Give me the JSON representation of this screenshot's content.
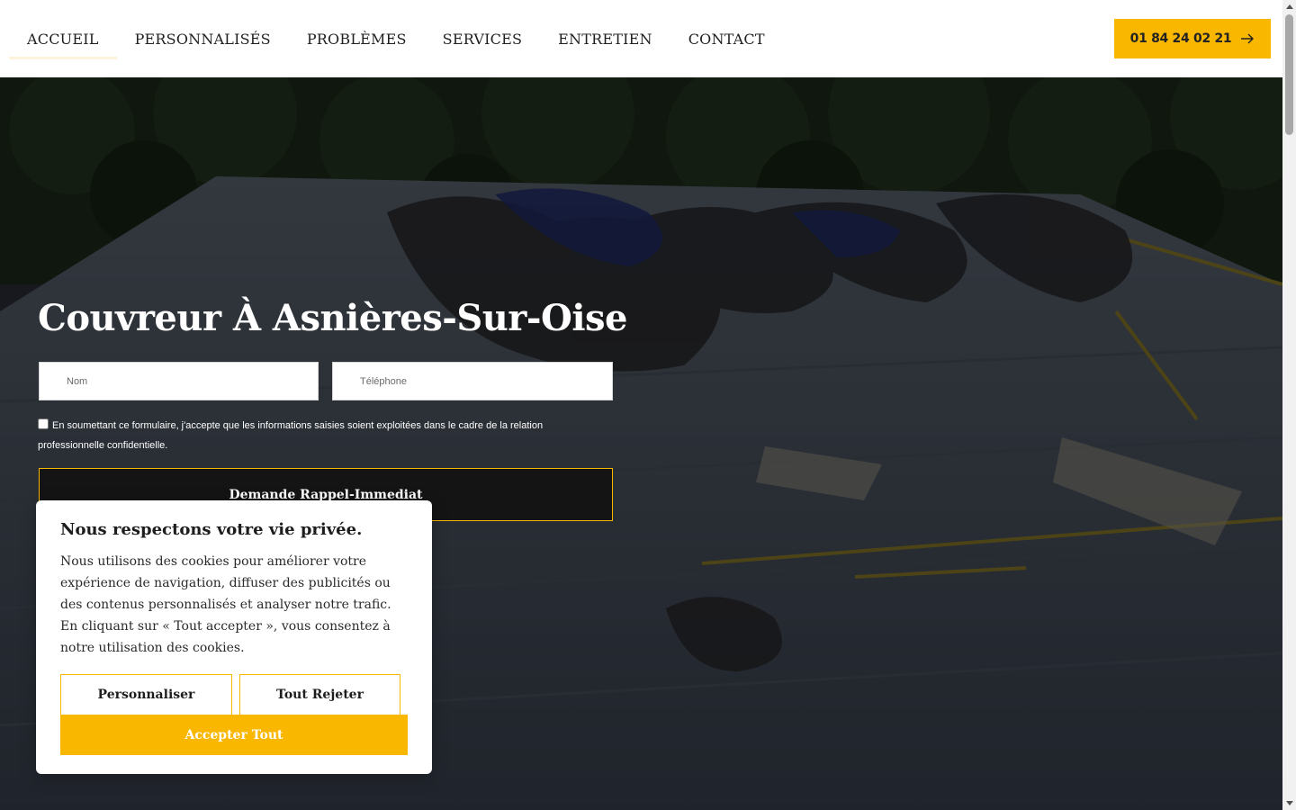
{
  "nav": {
    "items": [
      {
        "label": "ACCUEIL",
        "active": true
      },
      {
        "label": "PERSONNALISÉS",
        "active": false
      },
      {
        "label": "PROBLÈMES",
        "active": false
      },
      {
        "label": "SERVICES",
        "active": false
      },
      {
        "label": "ENTRETIEN",
        "active": false
      },
      {
        "label": "CONTACT",
        "active": false
      }
    ],
    "phone_label": "01 84 24 02 21",
    "phone_icon": "arrow-right-icon"
  },
  "hero": {
    "title": "Couvreur À Asnières-Sur-Oise",
    "name_placeholder": "Nom",
    "phone_placeholder": "Téléphone",
    "consent_text": "En soumettant ce formulaire, j'accepte que les informations saisies soient exploitées dans le cadre de la relation professionnelle confidentielle.",
    "submit_label": "Demande Rappel-Immediat"
  },
  "cookie": {
    "title": "Nous respectons votre vie privée.",
    "text": "Nous utilisons des cookies pour améliorer votre expérience de navigation, diffuser des publicités ou des contenus personnalisés et analyser notre trafic. En cliquant sur « Tout accepter », vous consentez à notre utilisation des cookies.",
    "customize_label": "Personnaliser",
    "reject_label": "Tout Rejeter",
    "accept_label": "Accepter Tout"
  },
  "colors": {
    "accent": "#fab700",
    "dark": "#141414",
    "text": "#1f1f1f"
  }
}
